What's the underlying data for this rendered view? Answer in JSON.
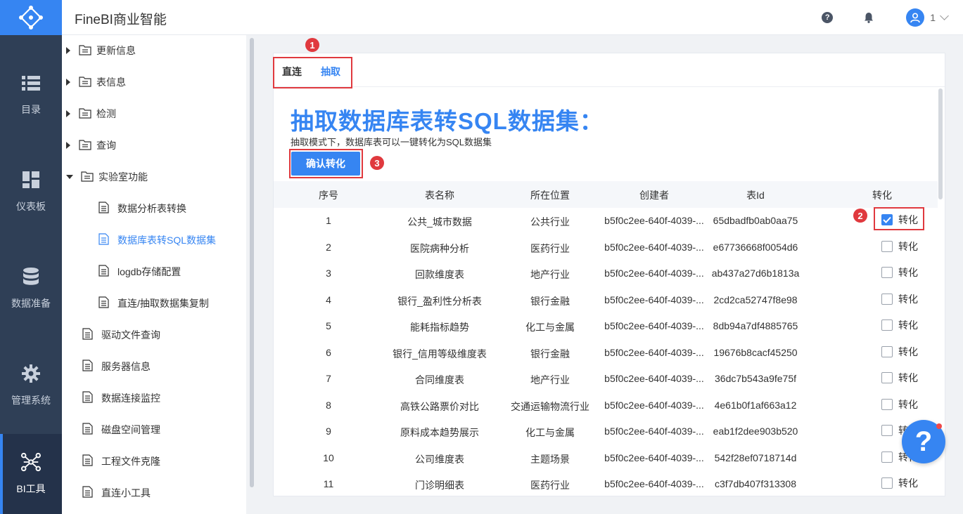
{
  "app": {
    "title": "FineBI商业智能",
    "user_num": "1"
  },
  "leftnav": [
    {
      "label": "目录",
      "icon": "list-icon"
    },
    {
      "label": "仪表板",
      "icon": "dashboard-icon"
    },
    {
      "label": "数据准备",
      "icon": "database-icon"
    },
    {
      "label": "管理系统",
      "icon": "gear-icon"
    },
    {
      "label": "BI工具",
      "icon": "network-icon",
      "active": true
    }
  ],
  "tree": [
    {
      "label": "更新信息",
      "type": "folder"
    },
    {
      "label": "表信息",
      "type": "folder"
    },
    {
      "label": "检测",
      "type": "folder"
    },
    {
      "label": "查询",
      "type": "folder"
    },
    {
      "label": "实验室功能",
      "type": "folder-open"
    },
    {
      "label": "数据分析表转换",
      "type": "doc-child"
    },
    {
      "label": "数据库表转SQL数据集",
      "type": "doc-child",
      "selected": true
    },
    {
      "label": "logdb存储配置",
      "type": "doc-child"
    },
    {
      "label": "直连/抽取数据集复制",
      "type": "doc-child"
    },
    {
      "label": "驱动文件查询",
      "type": "doc"
    },
    {
      "label": "服务器信息",
      "type": "doc"
    },
    {
      "label": "数据连接监控",
      "type": "doc"
    },
    {
      "label": "磁盘空间管理",
      "type": "doc"
    },
    {
      "label": "工程文件克隆",
      "type": "doc"
    },
    {
      "label": "直连小工具",
      "type": "doc"
    }
  ],
  "tabs": {
    "direct": "直连",
    "extract": "抽取"
  },
  "main": {
    "heading": "抽取数据库表转SQL数据集：",
    "subtext": "抽取模式下，数据库表可以一键转化为SQL数据集",
    "confirm_label": "确认转化"
  },
  "markers": {
    "m1": "1",
    "m2": "2",
    "m3": "3"
  },
  "table": {
    "headers": [
      "序号",
      "表名称",
      "所在位置",
      "创建者",
      "表Id",
      "转化"
    ],
    "checkbox_label": "转化",
    "rows": [
      {
        "no": "1",
        "name": "公共_城市数据",
        "loc": "公共行业",
        "creator": "b5f0c2ee-640f-4039-...",
        "id": "65dbadfb0ab0aa75",
        "checked": true
      },
      {
        "no": "2",
        "name": "医院病种分析",
        "loc": "医药行业",
        "creator": "b5f0c2ee-640f-4039-...",
        "id": "e67736668f0054d6",
        "checked": false
      },
      {
        "no": "3",
        "name": "回款维度表",
        "loc": "地产行业",
        "creator": "b5f0c2ee-640f-4039-...",
        "id": "ab437a27d6b1813a",
        "checked": false
      },
      {
        "no": "4",
        "name": "银行_盈利性分析表",
        "loc": "银行金融",
        "creator": "b5f0c2ee-640f-4039-...",
        "id": "2cd2ca52747f8e98",
        "checked": false
      },
      {
        "no": "5",
        "name": "能耗指标趋势",
        "loc": "化工与金属",
        "creator": "b5f0c2ee-640f-4039-...",
        "id": "8db94a7df4885765",
        "checked": false
      },
      {
        "no": "6",
        "name": "银行_信用等级维度表",
        "loc": "银行金融",
        "creator": "b5f0c2ee-640f-4039-...",
        "id": "19676b8cacf45250",
        "checked": false
      },
      {
        "no": "7",
        "name": "合同维度表",
        "loc": "地产行业",
        "creator": "b5f0c2ee-640f-4039-...",
        "id": "36dc7b543a9fe75f",
        "checked": false
      },
      {
        "no": "8",
        "name": "高铁公路票价对比",
        "loc": "交通运输物流行业",
        "creator": "b5f0c2ee-640f-4039-...",
        "id": "4e61b0f1af663a12",
        "checked": false
      },
      {
        "no": "9",
        "name": "原料成本趋势展示",
        "loc": "化工与金属",
        "creator": "b5f0c2ee-640f-4039-...",
        "id": "eab1f2dee903b520",
        "checked": false
      },
      {
        "no": "10",
        "name": "公司维度表",
        "loc": "主题场景",
        "creator": "b5f0c2ee-640f-4039-...",
        "id": "542f28ef0718714d",
        "checked": false
      },
      {
        "no": "11",
        "name": "门诊明细表",
        "loc": "医药行业",
        "creator": "b5f0c2ee-640f-4039-...",
        "id": "c3f7db407f313308",
        "checked": false
      }
    ]
  },
  "fab": {
    "label": "?"
  },
  "colors": {
    "accent": "#3685f2",
    "nav_bg": "#2f3f56",
    "highlight": "#e0393e"
  }
}
